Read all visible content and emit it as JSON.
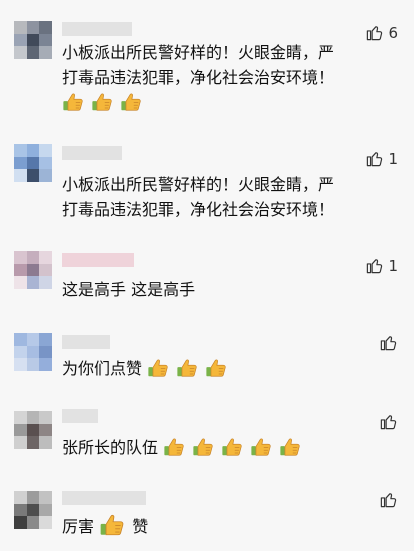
{
  "comments": [
    {
      "likes": "6",
      "lines": [
        "小板派出所民警好样的！火眼金睛，严",
        "打毒品违法犯罪，净化社会治安环境！"
      ],
      "emoji_count": 3
    },
    {
      "likes": "1",
      "lines": [
        "小板派出所民警好样的！火眼金睛，严",
        "打毒品违法犯罪，净化社会治安环境！"
      ],
      "emoji_count": 0
    },
    {
      "likes": "1",
      "text": "这是高手 这是高手"
    },
    {
      "likes": "",
      "text": "为你们点赞",
      "emoji_count": 3
    },
    {
      "likes": "",
      "text": "张所长的队伍",
      "emoji_count": 5
    },
    {
      "likes": "",
      "text_before": "厉害",
      "text_after": "赞"
    }
  ],
  "icons": {
    "like": "thumbs-up-outline-icon",
    "emoji": "thumbs-up-emoji-icon"
  },
  "colors": {
    "background": "#f7f7f7",
    "emoji_yellow": "#f5b73a",
    "cuff_green": "#7ab348"
  }
}
